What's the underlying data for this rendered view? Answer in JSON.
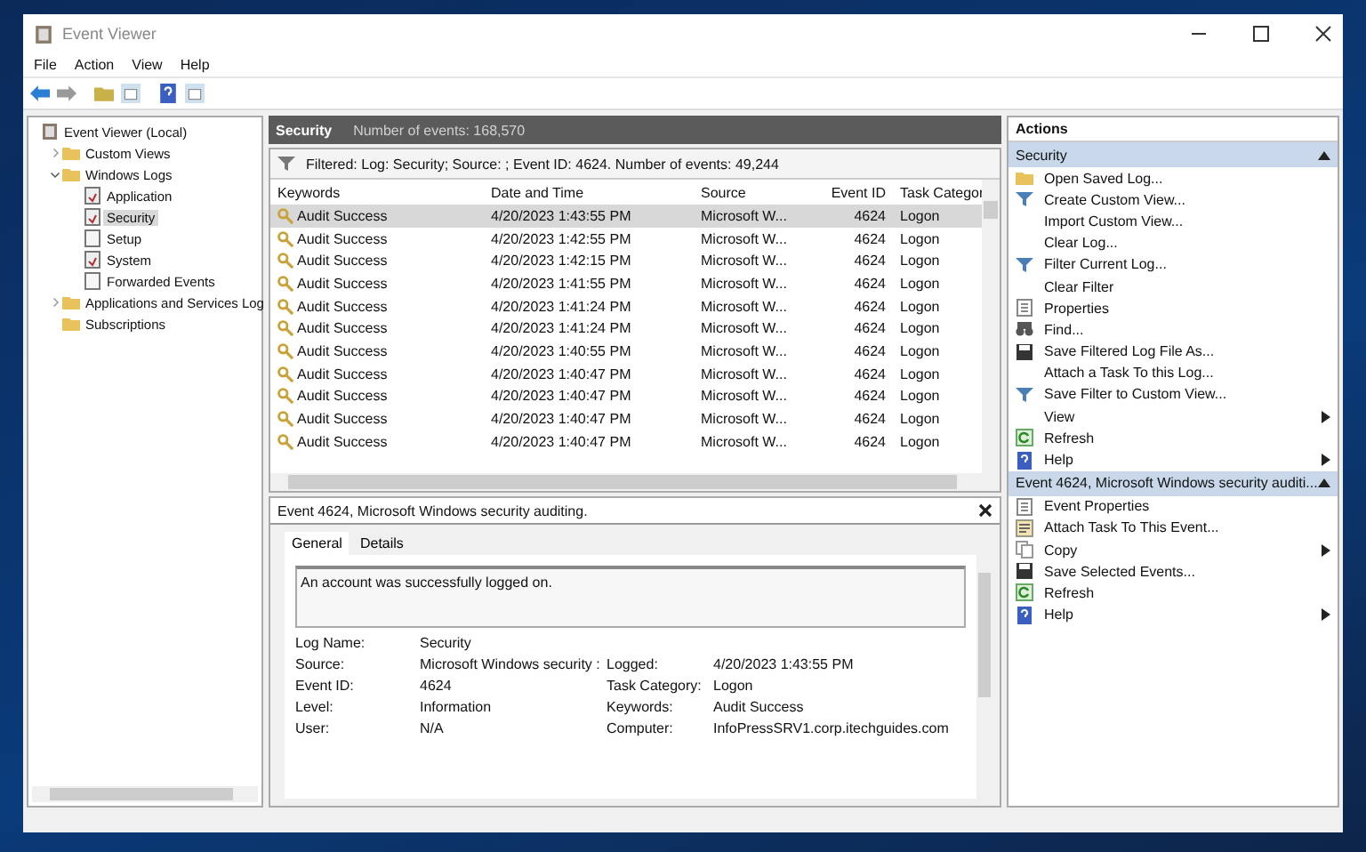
{
  "window": {
    "title": "Event Viewer"
  },
  "menu": [
    "File",
    "Action",
    "View",
    "Help"
  ],
  "tree": [
    {
      "label": "Event Viewer (Local)",
      "kind": "root",
      "selected": false,
      "children": [
        {
          "label": "Custom Views",
          "kind": "folder",
          "selected": false,
          "expanded": false
        },
        {
          "label": "Windows Logs",
          "kind": "folder",
          "selected": false,
          "expanded": true,
          "children": [
            {
              "label": "Application",
              "kind": "log",
              "selected": false
            },
            {
              "label": "Security",
              "kind": "log",
              "selected": true
            },
            {
              "label": "Setup",
              "kind": "blank",
              "selected": false
            },
            {
              "label": "System",
              "kind": "log",
              "selected": false
            },
            {
              "label": "Forwarded Events",
              "kind": "blank",
              "selected": false
            }
          ]
        },
        {
          "label": "Applications and Services Log",
          "kind": "folder",
          "selected": false,
          "expanded": false
        },
        {
          "label": "Subscriptions",
          "kind": "folder",
          "selected": false
        }
      ]
    }
  ],
  "log_header": {
    "title": "Security",
    "count": "Number of events: 168,570"
  },
  "filter": "Filtered: Log: Security; Source: ; Event ID: 4624. Number of events: 49,244",
  "table": {
    "columns": [
      "Keywords",
      "Date and Time",
      "Source",
      "Event ID",
      "Task Categor"
    ],
    "rows": [
      {
        "cells": [
          "Audit Success",
          "4/20/2023 1:43:55 PM",
          "Microsoft W...",
          "4624",
          "Logon"
        ],
        "selected": true
      },
      {
        "cells": [
          "Audit Success",
          "4/20/2023 1:42:55 PM",
          "Microsoft W...",
          "4624",
          "Logon"
        ],
        "selected": false
      },
      {
        "cells": [
          "Audit Success",
          "4/20/2023 1:42:15 PM",
          "Microsoft W...",
          "4624",
          "Logon"
        ],
        "selected": false
      },
      {
        "cells": [
          "Audit Success",
          "4/20/2023 1:41:55 PM",
          "Microsoft W...",
          "4624",
          "Logon"
        ],
        "selected": false
      },
      {
        "cells": [
          "Audit Success",
          "4/20/2023 1:41:24 PM",
          "Microsoft W...",
          "4624",
          "Logon"
        ],
        "selected": false
      },
      {
        "cells": [
          "Audit Success",
          "4/20/2023 1:41:24 PM",
          "Microsoft W...",
          "4624",
          "Logon"
        ],
        "selected": false
      },
      {
        "cells": [
          "Audit Success",
          "4/20/2023 1:40:55 PM",
          "Microsoft W...",
          "4624",
          "Logon"
        ],
        "selected": false
      },
      {
        "cells": [
          "Audit Success",
          "4/20/2023 1:40:47 PM",
          "Microsoft W...",
          "4624",
          "Logon"
        ],
        "selected": false
      },
      {
        "cells": [
          "Audit Success",
          "4/20/2023 1:40:47 PM",
          "Microsoft W...",
          "4624",
          "Logon"
        ],
        "selected": false
      },
      {
        "cells": [
          "Audit Success",
          "4/20/2023 1:40:47 PM",
          "Microsoft W...",
          "4624",
          "Logon"
        ],
        "selected": false
      },
      {
        "cells": [
          "Audit Success",
          "4/20/2023 1:40:47 PM",
          "Microsoft W...",
          "4624",
          "Logon"
        ],
        "selected": false
      }
    ]
  },
  "event": {
    "title": "Event 4624, Microsoft Windows security auditing.",
    "tabs": [
      {
        "label": "General",
        "selected": true
      },
      {
        "label": "Details",
        "selected": false
      }
    ],
    "message": "An account was successfully logged on.",
    "fields": [
      {
        "label": "Log Name:",
        "value": "Security"
      },
      {
        "label": "Source:",
        "value": "Microsoft Windows security :",
        "label_2": "Logged:",
        "value_2": "4/20/2023 1:43:55 PM"
      },
      {
        "label": "Event ID:",
        "value": "4624",
        "label_2": "Task Category:",
        "value_2": "Logon"
      },
      {
        "label": "Level:",
        "value": "Information",
        "label_2": "Keywords:",
        "value_2": "Audit Success"
      },
      {
        "label": "User:",
        "value": "N/A",
        "label_2": "Computer:",
        "value_2": "InfoPressSRV1.corp.itechguides.com"
      }
    ]
  },
  "actions": {
    "title": "Actions",
    "sections": [
      {
        "title": "Security",
        "expanded": true,
        "items": [
          {
            "label": "Open Saved Log...",
            "kind": "folder",
            "submenu": false
          },
          {
            "label": "Create Custom View...",
            "kind": "filter",
            "submenu": false
          },
          {
            "label": "Import Custom View...",
            "kind": "none",
            "submenu": false
          },
          {
            "label": "Clear Log...",
            "kind": "none",
            "submenu": false
          },
          {
            "label": "Filter Current Log...",
            "kind": "filter",
            "submenu": false
          },
          {
            "label": "Clear Filter",
            "kind": "none",
            "submenu": false
          },
          {
            "label": "Properties",
            "kind": "properties",
            "submenu": false
          },
          {
            "label": "Find...",
            "kind": "find",
            "submenu": false
          },
          {
            "label": "Save Filtered Log File As...",
            "kind": "save",
            "submenu": false
          },
          {
            "label": "Attach a Task To this Log...",
            "kind": "none",
            "submenu": false
          },
          {
            "label": "Save Filter to Custom View...",
            "kind": "filter",
            "submenu": false
          },
          {
            "label": "View",
            "kind": "none",
            "submenu": true
          },
          {
            "label": "Refresh",
            "kind": "refresh",
            "submenu": false
          },
          {
            "label": "Help",
            "kind": "help",
            "submenu": true
          }
        ]
      },
      {
        "title": "Event 4624, Microsoft Windows security auditi...",
        "expanded": true,
        "items": [
          {
            "label": "Event Properties",
            "kind": "properties",
            "submenu": false
          },
          {
            "label": "Attach Task To This Event...",
            "kind": "task",
            "submenu": false
          },
          {
            "label": "Copy",
            "kind": "copy",
            "submenu": true
          },
          {
            "label": "Save Selected Events...",
            "kind": "save",
            "submenu": false
          },
          {
            "label": "Refresh",
            "kind": "refresh",
            "submenu": false
          },
          {
            "label": "Help",
            "kind": "help",
            "submenu": true
          }
        ]
      }
    ]
  }
}
